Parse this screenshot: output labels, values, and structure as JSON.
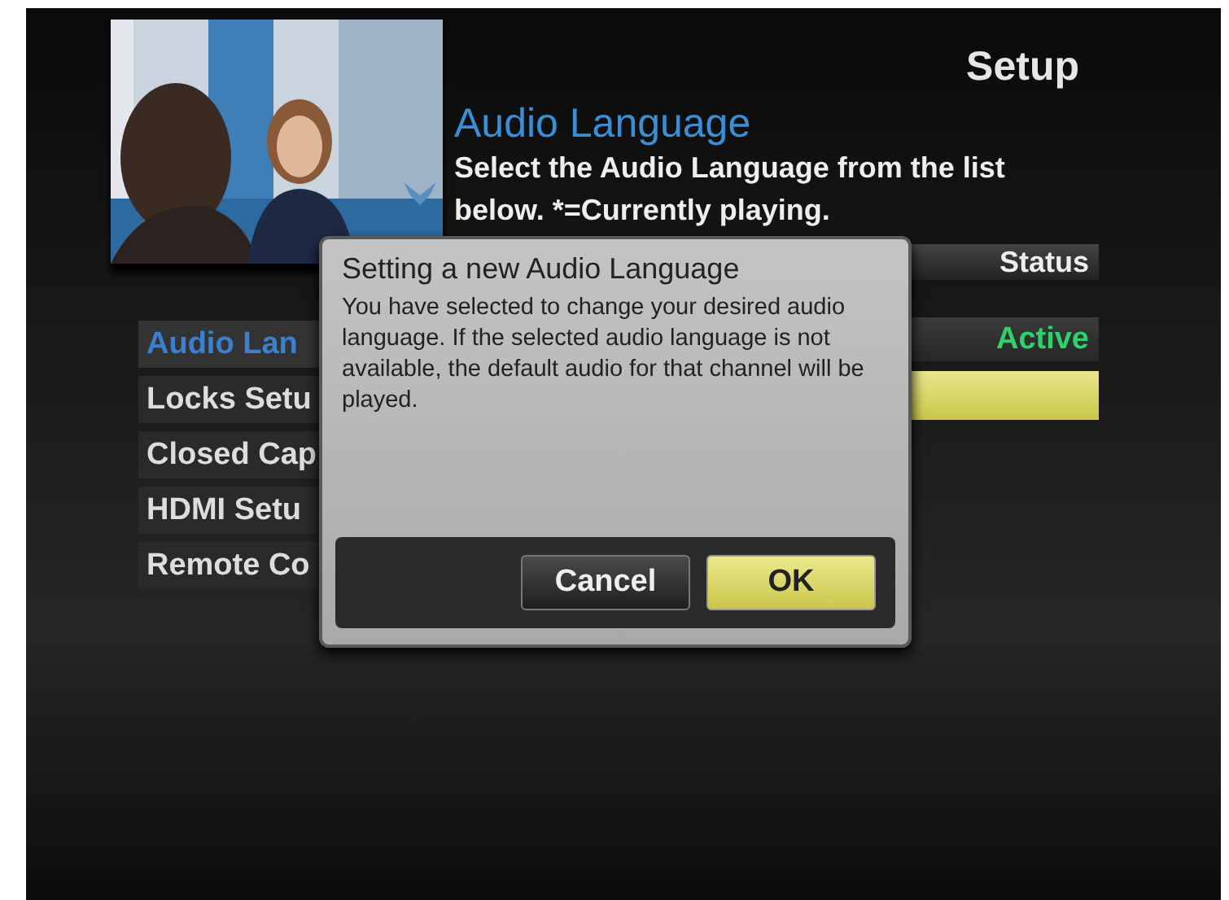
{
  "screen_title": "Setup",
  "heading": "Audio Language",
  "description": "Select the Audio Language from the list below. *=Currently playing.",
  "status_column": {
    "header": "Status",
    "rows": [
      {
        "text": "Active",
        "selected": false
      },
      {
        "selected": true
      }
    ]
  },
  "menu": [
    {
      "label": "Audio Lan",
      "selected": true
    },
    {
      "label": "Locks Setu",
      "selected": false
    },
    {
      "label": "Closed Cap",
      "selected": false
    },
    {
      "label": "HDMI Setu",
      "selected": false
    },
    {
      "label": "Remote Co",
      "selected": false
    }
  ],
  "dialog": {
    "title": "Setting a new Audio Language",
    "message": "You have selected to change your desired audio language. If the selected audio language is not available, the default audio for that channel will be played.",
    "buttons": [
      {
        "label": "Cancel",
        "selected": false
      },
      {
        "label": "OK",
        "selected": true
      }
    ]
  }
}
